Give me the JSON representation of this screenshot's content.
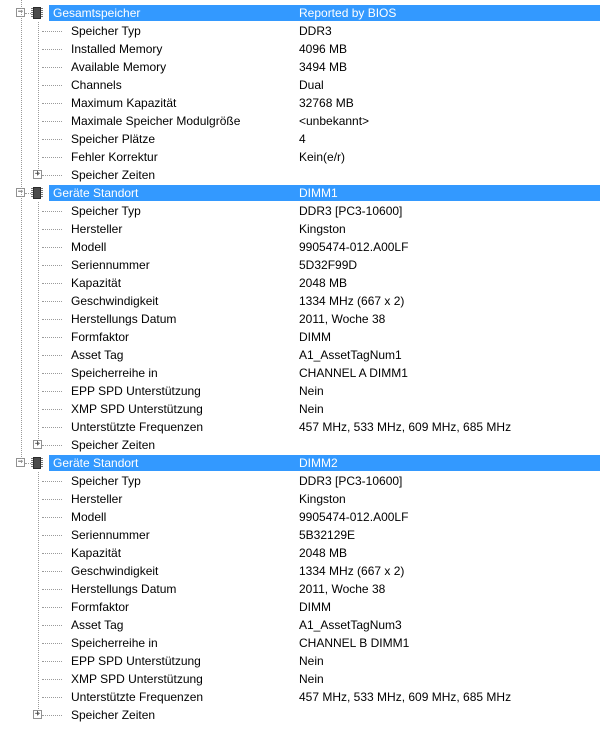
{
  "sections": [
    {
      "title": "Gesamtspeicher",
      "value": "Reported by BIOS",
      "items": [
        {
          "label": "Speicher Typ",
          "value": "DDR3"
        },
        {
          "label": "Installed Memory",
          "value": "4096 MB"
        },
        {
          "label": "Available Memory",
          "value": "3494 MB"
        },
        {
          "label": "Channels",
          "value": "Dual"
        },
        {
          "label": "Maximum Kapazität",
          "value": "32768 MB"
        },
        {
          "label": "Maximale Speicher Modulgröße",
          "value": "<unbekannt>"
        },
        {
          "label": "Speicher Plätze",
          "value": "4"
        },
        {
          "label": "Fehler Korrektur",
          "value": "Kein(e/r)"
        },
        {
          "label": "Speicher Zeiten",
          "value": "",
          "expandable": true
        }
      ]
    },
    {
      "title": "Geräte Standort",
      "value": "DIMM1",
      "items": [
        {
          "label": "Speicher Typ",
          "value": "DDR3 [PC3-10600]"
        },
        {
          "label": "Hersteller",
          "value": "Kingston"
        },
        {
          "label": "Modell",
          "value": "9905474-012.A00LF"
        },
        {
          "label": "Seriennummer",
          "value": "5D32F99D"
        },
        {
          "label": "Kapazität",
          "value": "2048 MB"
        },
        {
          "label": "Geschwindigkeit",
          "value": "1334 MHz (667 x 2)"
        },
        {
          "label": "Herstellungs Datum",
          "value": "2011, Woche 38"
        },
        {
          "label": "Formfaktor",
          "value": "DIMM"
        },
        {
          "label": "Asset Tag",
          "value": "A1_AssetTagNum1"
        },
        {
          "label": "Speicherreihe in",
          "value": "CHANNEL A DIMM1"
        },
        {
          "label": "EPP SPD Unterstützung",
          "value": "Nein"
        },
        {
          "label": "XMP SPD Unterstützung",
          "value": "Nein"
        },
        {
          "label": "Unterstützte Frequenzen",
          "value": "457 MHz, 533 MHz, 609 MHz, 685 MHz"
        },
        {
          "label": "Speicher Zeiten",
          "value": "",
          "expandable": true
        }
      ]
    },
    {
      "title": "Geräte Standort",
      "value": "DIMM2",
      "items": [
        {
          "label": "Speicher Typ",
          "value": "DDR3 [PC3-10600]"
        },
        {
          "label": "Hersteller",
          "value": "Kingston"
        },
        {
          "label": "Modell",
          "value": "9905474-012.A00LF"
        },
        {
          "label": "Seriennummer",
          "value": "5B32129E"
        },
        {
          "label": "Kapazität",
          "value": "2048 MB"
        },
        {
          "label": "Geschwindigkeit",
          "value": "1334 MHz (667 x 2)"
        },
        {
          "label": "Herstellungs Datum",
          "value": "2011, Woche 38"
        },
        {
          "label": "Formfaktor",
          "value": "DIMM"
        },
        {
          "label": "Asset Tag",
          "value": "A1_AssetTagNum3"
        },
        {
          "label": "Speicherreihe in",
          "value": "CHANNEL B DIMM1"
        },
        {
          "label": "EPP SPD Unterstützung",
          "value": "Nein"
        },
        {
          "label": "XMP SPD Unterstützung",
          "value": "Nein"
        },
        {
          "label": "Unterstützte Frequenzen",
          "value": "457 MHz, 533 MHz, 609 MHz, 685 MHz"
        },
        {
          "label": "Speicher Zeiten",
          "value": "",
          "expandable": true
        }
      ]
    }
  ],
  "icons": {
    "section_icon": "memory-chip-icon",
    "collapse_glyph": "−",
    "expand_glyph": "+"
  },
  "colors": {
    "selection": "#3399ff",
    "tree_line": "#9a9a9a"
  }
}
